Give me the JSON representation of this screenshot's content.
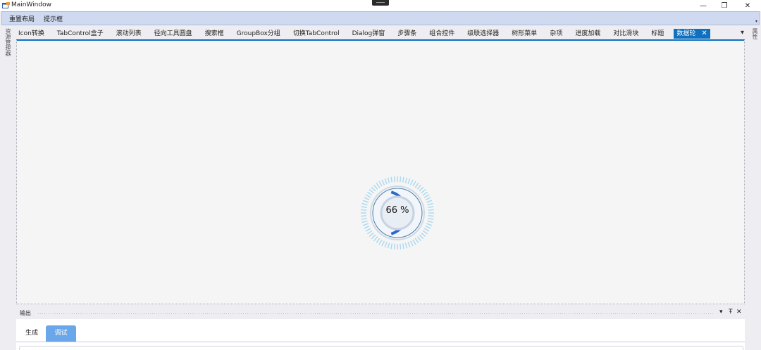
{
  "window": {
    "title": "MainWindow",
    "minimize_glyph": "—",
    "restore_glyph": "❐",
    "close_glyph": "✕"
  },
  "menu": {
    "items": [
      "重置布局",
      "提示框"
    ]
  },
  "side": {
    "left_label": "资源管理器",
    "right_label": "属性"
  },
  "tabs": {
    "items": [
      "Icon转换",
      "TabControl盒子",
      "滚动列表",
      "径向工具圆盘",
      "搜索框",
      "GroupBox分组",
      "切换TabControl",
      "Dialog弹窗",
      "步骤条",
      "组合控件",
      "级联选择器",
      "树形菜单",
      "杂项",
      "进度加载",
      "对比滑块",
      "标题"
    ],
    "active": "数据轮",
    "active_close": "✕",
    "overflow_glyph": "▾"
  },
  "gauge": {
    "value": 66,
    "label": "66 %",
    "colors": {
      "progress": "#2d68c8",
      "ticks": "#a8d8f0",
      "ring": "#4a7fa8"
    }
  },
  "output": {
    "title": "输出",
    "dropdown_glyph": "▾",
    "pin_glyph": "Ŧ",
    "close_glyph": "✕",
    "tabs": [
      "生成",
      "调试"
    ],
    "active_tab": "调试"
  }
}
